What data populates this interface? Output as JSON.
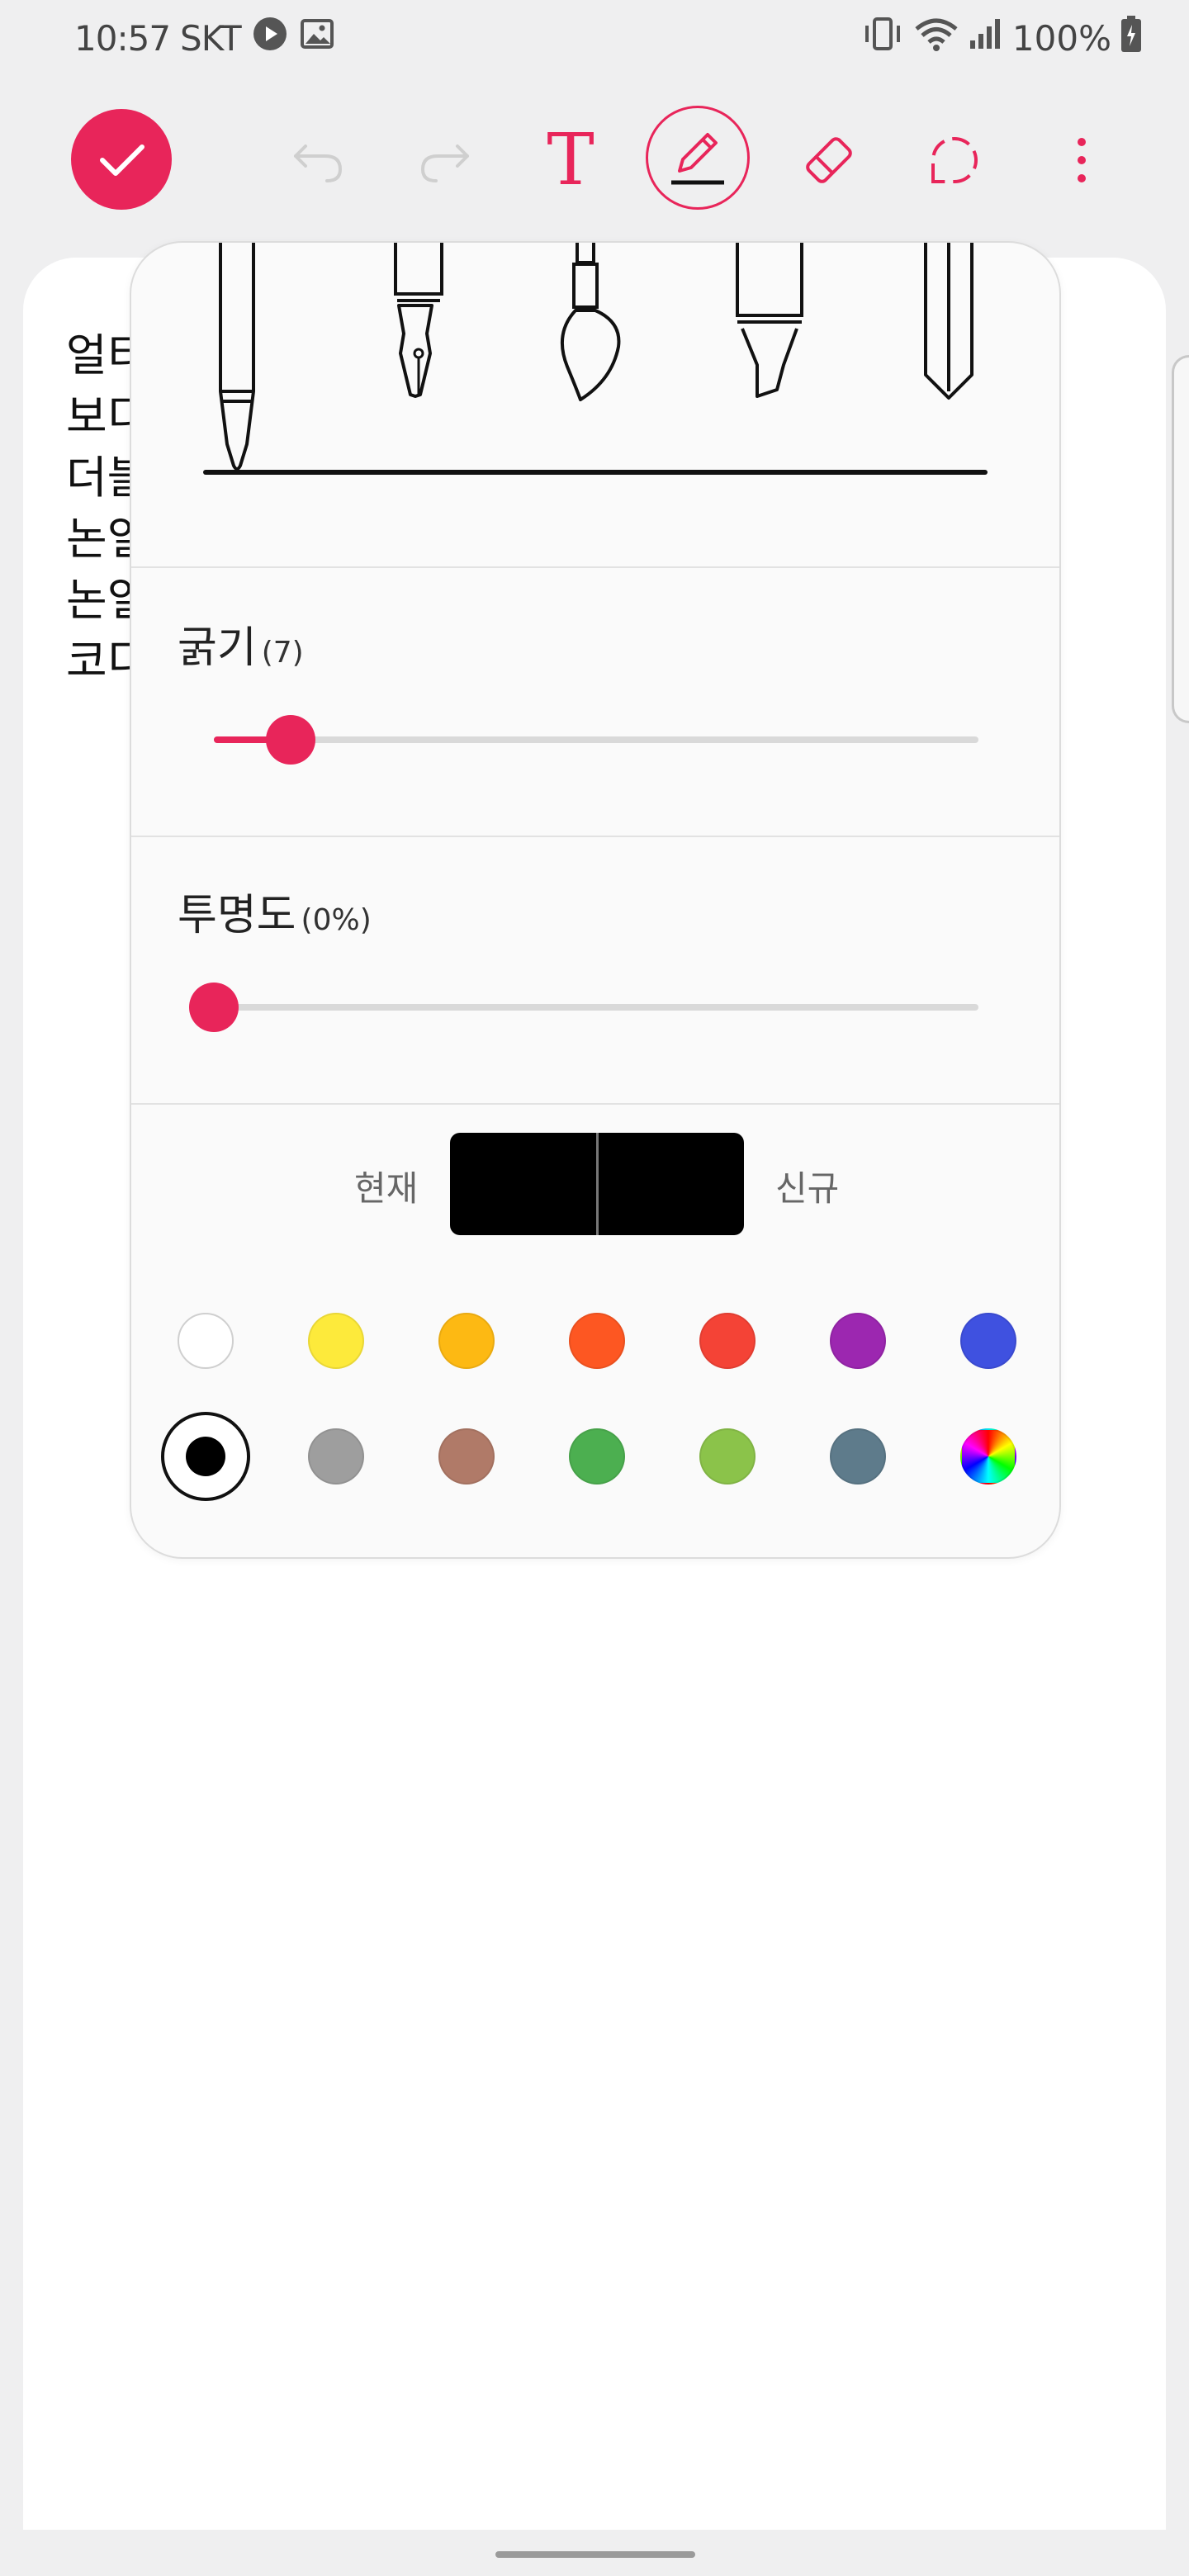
{
  "status_bar": {
    "time": "10:57",
    "carrier": "SKT",
    "battery": "100%",
    "icons_left": [
      "play-icon",
      "image-icon"
    ],
    "icons_right": [
      "vibrate-icon",
      "wifi-icon",
      "signal-icon",
      "battery-icon"
    ]
  },
  "toolbar": {
    "text_tool_glyph": "T",
    "items": [
      "done",
      "undo",
      "redo",
      "text",
      "pen",
      "eraser",
      "lasso",
      "more"
    ],
    "active": "pen"
  },
  "note": {
    "lines": [
      "얼티",
      "보디",
      "더블",
      "논일",
      "논일",
      "코디"
    ]
  },
  "pen_popup": {
    "pen_types": [
      "ballpoint-pen",
      "fountain-pen",
      "brush",
      "highlighter",
      "calligraphy-pen"
    ],
    "selected_pen": "ballpoint-pen",
    "thickness": {
      "label": "굵기",
      "value_text": "(7)",
      "value": 7,
      "fill_fraction": 0.1
    },
    "opacity": {
      "label": "투명도",
      "value_text": "(0%)",
      "value": 0,
      "fill_fraction": 0.0
    },
    "preview": {
      "current_label": "현재",
      "new_label": "신규",
      "current_color": "#000000",
      "new_color": "#000000"
    },
    "palette_row1": [
      "#ffffff",
      "#fdea3b",
      "#fdb913",
      "#fd5722",
      "#f44336",
      "#9c27b0",
      "#3f51e0"
    ],
    "palette_row2": [
      "#000000",
      "#9e9e9e",
      "#b07a68",
      "#4caf50",
      "#8bc34a",
      "#5e7b8b",
      "rainbow"
    ],
    "selected_color": "#000000"
  },
  "theme": {
    "accent": "#e8255a"
  }
}
